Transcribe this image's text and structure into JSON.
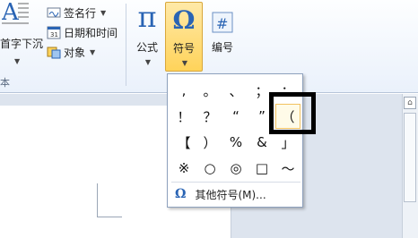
{
  "ribbon": {
    "left_text": "首字下沉",
    "group_label": "本",
    "signature_line": "签名行",
    "date_time": "日期和时间",
    "object": "对象",
    "formula": "公式",
    "symbol": "符号",
    "number": "编号"
  },
  "symbol_menu": {
    "symbols": [
      ",",
      "。",
      "、",
      "；",
      "：",
      "！",
      "？",
      "“",
      "”",
      "（",
      "【",
      "）",
      "%",
      "&",
      "」",
      "※",
      "○",
      "◎",
      "□",
      "～"
    ],
    "selected_index": 9,
    "more_symbols": "其他符号(M)..."
  },
  "colors": {
    "accent": "#2a64b4",
    "active_button": "#ffd35a",
    "highlight": "#000000"
  }
}
